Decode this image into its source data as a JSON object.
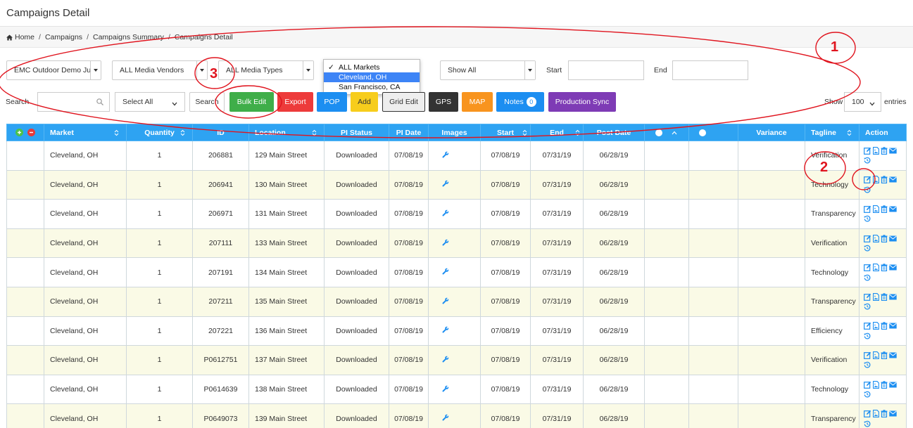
{
  "header": {
    "title": "Campaigns Detail"
  },
  "breadcrumb": [
    "Home",
    "Campaigns",
    "Campaigns Summary",
    "Campaigns Detail"
  ],
  "filters": {
    "campaign": "EMC Outdoor Demo Ju",
    "vendors": "ALL Media Vendors",
    "media_types": "ALL Media Types",
    "show": "Show All",
    "start_label": "Start",
    "end_label": "End"
  },
  "markets_dropdown": {
    "options": [
      "ALL Markets",
      "Cleveland, OH",
      "San Francisco, CA"
    ],
    "checked_glyph": "✓"
  },
  "toolbar": {
    "search_label": "Search",
    "select_all": "Select All",
    "search_button": "Search",
    "bulk_edit": "Bulk Edit",
    "export": "Export",
    "pop": "POP",
    "add": "Add",
    "grid_edit": "Grid Edit",
    "gps": "GPS",
    "map": "MAP",
    "notes": "Notes",
    "notes_count": "0",
    "production_sync": "Production Sync",
    "show_label": "Show",
    "entries_value": "100",
    "entries_label": "entries"
  },
  "colors": {
    "header_blue": "#2ea3f2",
    "green": "#3fae49",
    "red": "#ed3b3b",
    "blue": "#1c8ef1",
    "yellow": "#f7cd1c",
    "dark": "#333333",
    "orange": "#f8941e",
    "purple": "#7e3bb5",
    "annotation": "#e0141e"
  },
  "table": {
    "columns": [
      "Market",
      "Quantity",
      "ID",
      "Location",
      "PI Status",
      "PI Date",
      "Images",
      "Start",
      "End",
      "Post Date",
      "",
      "",
      "Variance",
      "Tagline",
      "Action"
    ],
    "rows": [
      [
        "Cleveland, OH",
        "1",
        "206881",
        "129 Main Street",
        "Downloaded",
        "07/08/19",
        "07/08/19",
        "07/31/19",
        "06/28/19",
        "Verification"
      ],
      [
        "Cleveland, OH",
        "1",
        "206941",
        "130 Main Street",
        "Downloaded",
        "07/08/19",
        "07/08/19",
        "07/31/19",
        "06/28/19",
        "Technology"
      ],
      [
        "Cleveland, OH",
        "1",
        "206971",
        "131 Main Street",
        "Downloaded",
        "07/08/19",
        "07/08/19",
        "07/31/19",
        "06/28/19",
        "Transparency"
      ],
      [
        "Cleveland, OH",
        "1",
        "207111",
        "133 Main Street",
        "Downloaded",
        "07/08/19",
        "07/08/19",
        "07/31/19",
        "06/28/19",
        "Verification"
      ],
      [
        "Cleveland, OH",
        "1",
        "207191",
        "134 Main Street",
        "Downloaded",
        "07/08/19",
        "07/08/19",
        "07/31/19",
        "06/28/19",
        "Technology"
      ],
      [
        "Cleveland, OH",
        "1",
        "207211",
        "135 Main Street",
        "Downloaded",
        "07/08/19",
        "07/08/19",
        "07/31/19",
        "06/28/19",
        "Transparency"
      ],
      [
        "Cleveland, OH",
        "1",
        "207221",
        "136 Main Street",
        "Downloaded",
        "07/08/19",
        "07/08/19",
        "07/31/19",
        "06/28/19",
        "Efficiency"
      ],
      [
        "Cleveland, OH",
        "1",
        "P0612751",
        "137 Main Street",
        "Downloaded",
        "07/08/19",
        "07/08/19",
        "07/31/19",
        "06/28/19",
        "Verification"
      ],
      [
        "Cleveland, OH",
        "1",
        "P0614639",
        "138 Main Street",
        "Downloaded",
        "07/08/19",
        "07/08/19",
        "07/31/19",
        "06/28/19",
        "Technology"
      ],
      [
        "Cleveland, OH",
        "1",
        "P0649073",
        "139 Main Street",
        "Downloaded",
        "07/08/19",
        "07/08/19",
        "07/31/19",
        "06/28/19",
        "Transparency"
      ]
    ]
  },
  "annotations": [
    "1",
    "2",
    "3"
  ]
}
